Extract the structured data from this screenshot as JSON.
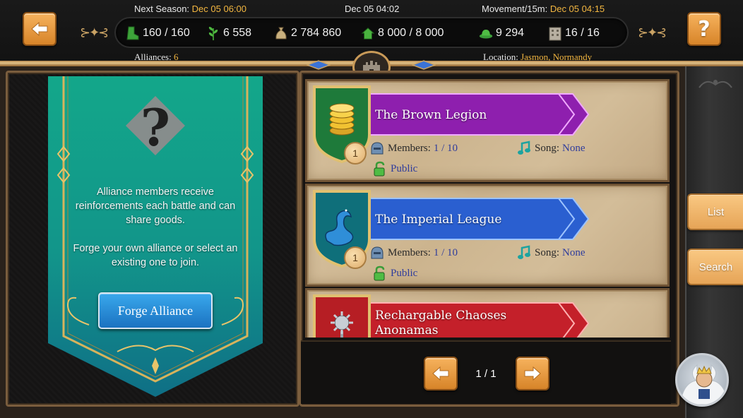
{
  "header": {
    "next_season_label": "Next Season:",
    "next_season_value": "Dec 05 06:00",
    "current_time": "Dec 05 04:02",
    "movement_label": "Movement/15m:",
    "movement_value": "Dec 05 04:15",
    "alliances_label": "Alliances:",
    "alliances_value": "6",
    "location_label": "Location:",
    "location_value": "Jasmon, Normandy",
    "help_label": "?"
  },
  "stats": [
    {
      "icon": "boot-icon",
      "value": "160 / 160"
    },
    {
      "icon": "herb-icon",
      "value": "6 558"
    },
    {
      "icon": "money-bag-icon",
      "value": "2 784 860"
    },
    {
      "icon": "house-icon",
      "value": "8 000 / 8 000"
    },
    {
      "icon": "hat-icon",
      "value": "9 294"
    },
    {
      "icon": "building-icon",
      "value": "16 / 16"
    }
  ],
  "banner": {
    "paragraph1": "Alliance members receive reinforcements each battle and can share goods.",
    "paragraph2": "Forge your own alliance or select an existing one to join.",
    "forge_button": "Forge Alliance"
  },
  "alliances": [
    {
      "name": "The Brown Legion",
      "level": "1",
      "members_label": "Members:",
      "members": "1 / 10",
      "song_label": "Song:",
      "song": "None",
      "access": "Public",
      "ribbon_color": "#8e1fae",
      "shield_color": "#1e7a3a",
      "crest_icon": "gold-coins-icon"
    },
    {
      "name": "The Imperial League",
      "level": "1",
      "members_label": "Members:",
      "members": "1 / 10",
      "song_label": "Song:",
      "song": "None",
      "access": "Public",
      "ribbon_color": "#2a5fd0",
      "shield_color": "#0f6f7a",
      "crest_icon": "sea-serpent-icon"
    },
    {
      "name": "Rechargable Chaoses Anonamas",
      "ribbon_color": "#c4202a",
      "shield_color": "#b61e24",
      "crest_icon": "morning-star-icon"
    }
  ],
  "pager": {
    "label": "1 / 1"
  },
  "side_tabs": {
    "list": "List",
    "search": "Search"
  },
  "colors": {
    "accent_orange": "#e39a3e",
    "link_gold": "#f2b640",
    "value_blue": "#2f3c9c"
  }
}
